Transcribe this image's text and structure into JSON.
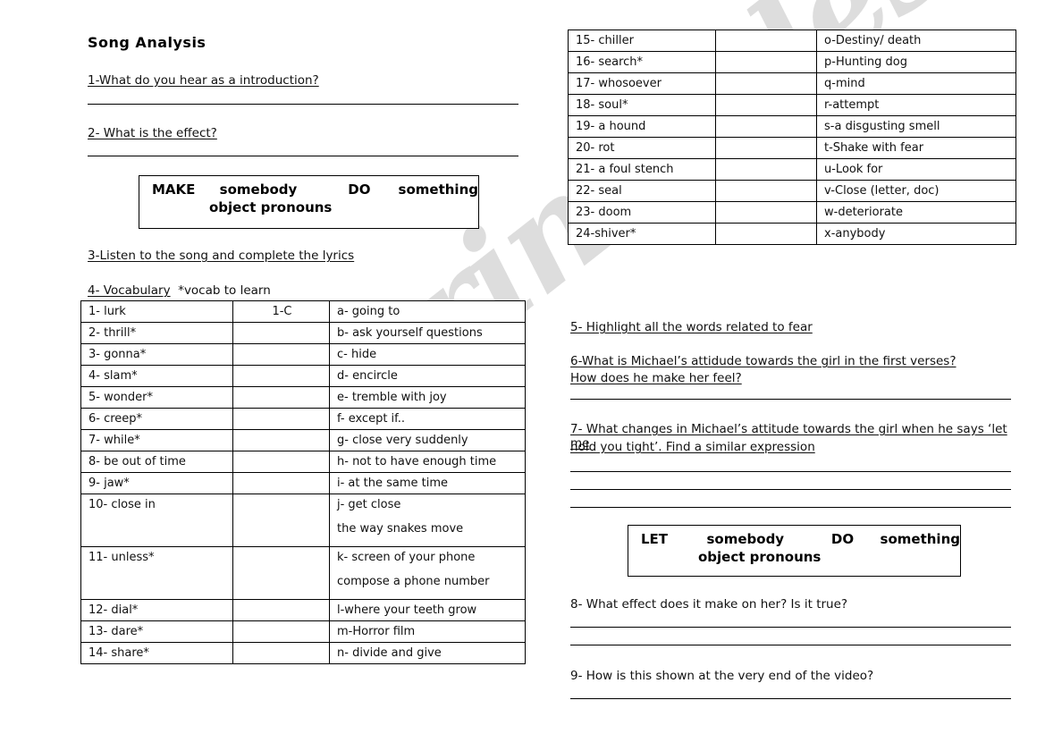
{
  "document": {
    "title": "Song Analysis",
    "watermark": "ESLprintables.com"
  },
  "left_column": {
    "q1": "1-What do you hear as a introduction?",
    "q2": "2- What is the effect?",
    "q3": "3-Listen to the song and complete the lyrics",
    "q4_label": "4- Vocabulary",
    "q4_note": "*vocab to learn",
    "grammar_box_make": {
      "word1": "MAKE",
      "word2": "somebody",
      "word3": "DO",
      "word4": "something",
      "line2": "object pronouns"
    }
  },
  "vocab_table_left": {
    "rows": [
      {
        "term": "1-   lurk",
        "answer": "1-C",
        "def": "a- going to",
        "def2": ""
      },
      {
        "term": "2-   thrill*",
        "answer": "",
        "def": "b- ask yourself questions",
        "def2": ""
      },
      {
        "term": "3-   gonna*",
        "answer": "",
        "def": "c- hide",
        "def2": ""
      },
      {
        "term": "4-   slam*",
        "answer": "",
        "def": "d- encircle",
        "def2": ""
      },
      {
        "term": "5-   wonder*",
        "answer": "",
        "def": "e- tremble with joy",
        "def2": ""
      },
      {
        "term": "6-   creep*",
        "answer": "",
        "def": "f- except if..",
        "def2": ""
      },
      {
        "term": "7-   while*",
        "answer": "",
        "def": "g- close very suddenly",
        "def2": ""
      },
      {
        "term": "8-   be out of time",
        "answer": "",
        "def": "h- not to have enough time",
        "def2": ""
      },
      {
        "term": "9-   jaw*",
        "answer": "",
        "def": "i- at the same time",
        "def2": ""
      },
      {
        "term": "10- close in",
        "answer": "",
        "def": "j- get close",
        "def2": " the way snakes move"
      },
      {
        "term": "11-  unless*",
        "answer": "",
        "def": "k- screen of your phone",
        "def2": "compose a phone number"
      },
      {
        "term": "12- dial*",
        "answer": "",
        "def": "l-where your teeth grow",
        "def2": ""
      },
      {
        "term": "13- dare*",
        "answer": "",
        "def": "m-Horror film",
        "def2": ""
      },
      {
        "term": "14- share*",
        "answer": "",
        "def": "n- divide and give",
        "def2": ""
      }
    ]
  },
  "vocab_table_right": {
    "rows": [
      {
        "term": "15- chiller",
        "answer": "",
        "def": "o-Destiny/ death",
        "def2": ""
      },
      {
        "term": "16-  search*",
        "answer": "",
        "def": "p-Hunting dog",
        "def2": ""
      },
      {
        "term": "17- whosoever",
        "answer": "",
        "def": "q-mind",
        "def2": ""
      },
      {
        "term": "18- soul*",
        "answer": "",
        "def": "r-attempt",
        "def2": ""
      },
      {
        "term": "19- a hound",
        "answer": "",
        "def": "s-a disgusting smell",
        "def2": ""
      },
      {
        "term": "20- rot",
        "answer": "",
        "def": "t-Shake with fear",
        "def2": ""
      },
      {
        "term": "21- a foul stench",
        "answer": "",
        "def": "u-Look for",
        "def2": ""
      },
      {
        "term": "22- seal",
        "answer": "",
        "def": "v-Close (letter, doc)",
        "def2": ""
      },
      {
        "term": "23- doom",
        "answer": "",
        "def": "w-deteriorate",
        "def2": ""
      },
      {
        "term": "24-shiver*",
        "answer": "",
        "def": "x-anybody",
        "def2": ""
      }
    ]
  },
  "right_column": {
    "q5": "5- Highlight all the words related to fear",
    "q6_line1": "6-What is Michael’s attidude towards the girl in the first verses?",
    "q6_line2": "How does he make her feel?",
    "q7_line1": "7- What changes in Michael’s attitude towards the girl when he says ‘let me",
    "q7_line2": "hold you tight’. Find a similar expression",
    "grammar_box_let": {
      "word1": "LET",
      "word2": "somebody",
      "word3": "DO",
      "word4": "something",
      "line2": "object pronouns"
    },
    "q8": "8- What effect does it make on her? Is it true?",
    "q9": "9- How is this shown at the very end of the video?"
  }
}
